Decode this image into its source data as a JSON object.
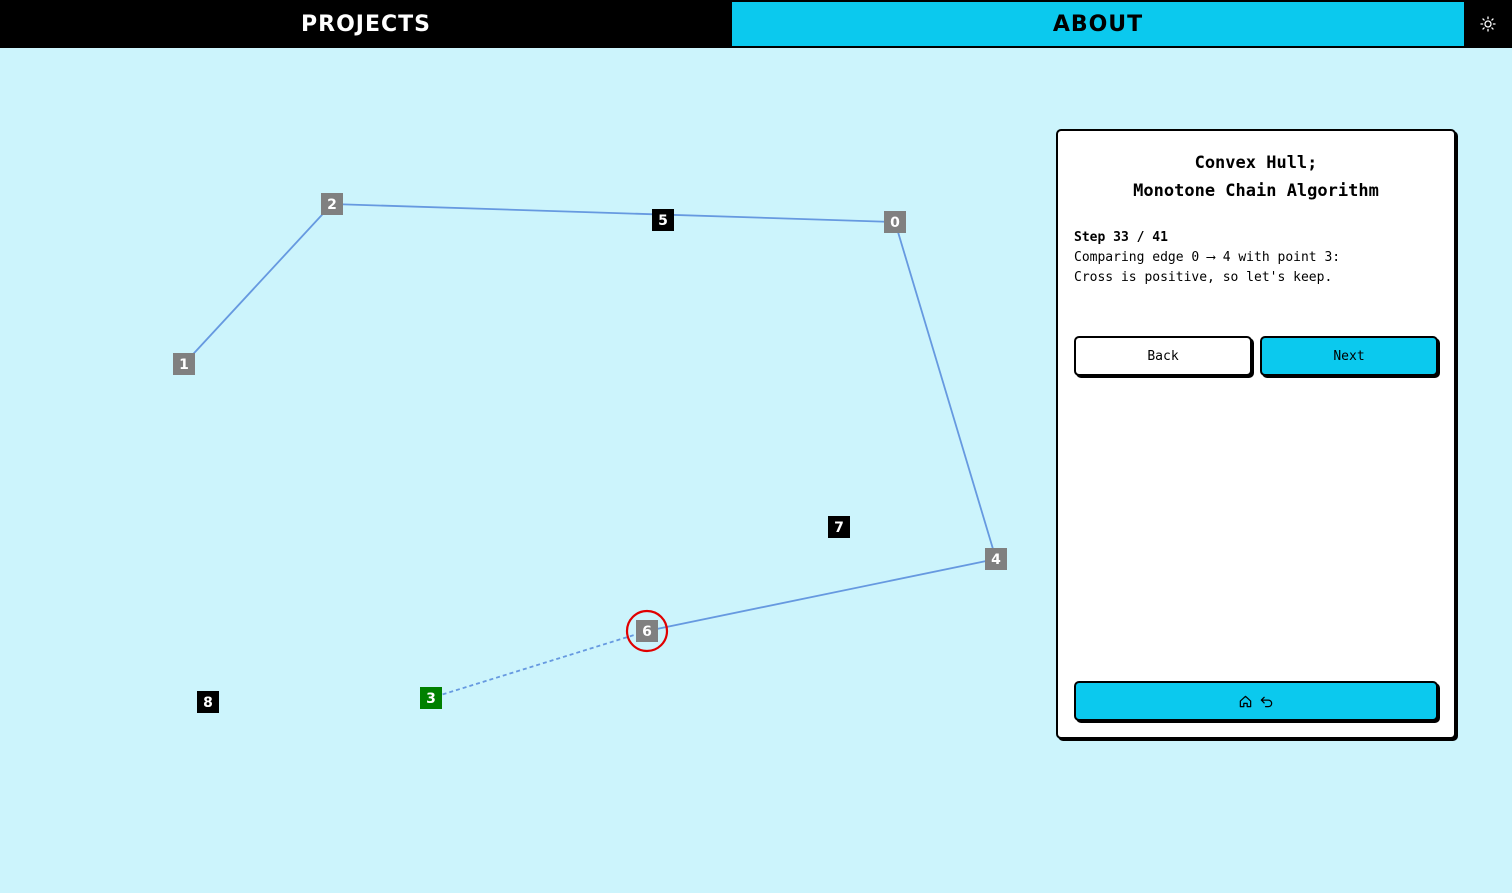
{
  "nav": {
    "projects_label": "PROJECTS",
    "about_label": "ABOUT",
    "theme_icon": "sun-icon"
  },
  "panel": {
    "title_line1": "Convex Hull;",
    "title_line2": "Monotone Chain Algorithm",
    "step_label": "Step 33 / 41",
    "description_line1": "Comparing edge 0 ⟶ 4 with point 3:",
    "description_line2": "Cross is positive, so let's keep.",
    "back_label": "Back",
    "next_label": "Next",
    "home_icon": "home-icon",
    "undo_icon": "undo-icon"
  },
  "points": [
    {
      "label": "0",
      "state": "hull"
    },
    {
      "label": "1",
      "state": "hull"
    },
    {
      "label": "2",
      "state": "hull"
    },
    {
      "label": "3",
      "state": "candidate"
    },
    {
      "label": "4",
      "state": "hull"
    },
    {
      "label": "5",
      "state": "unvisited"
    },
    {
      "label": "6",
      "state": "hull-current"
    },
    {
      "label": "7",
      "state": "unvisited"
    },
    {
      "label": "8",
      "state": "unvisited"
    }
  ],
  "colors": {
    "background": "#ccf4fc",
    "accent": "#0bc9ee",
    "hull_point": "#808080",
    "candidate_point": "#008000",
    "unvisited_point": "#000000",
    "edge": "#6699e0",
    "current_marker": "#e00000"
  }
}
